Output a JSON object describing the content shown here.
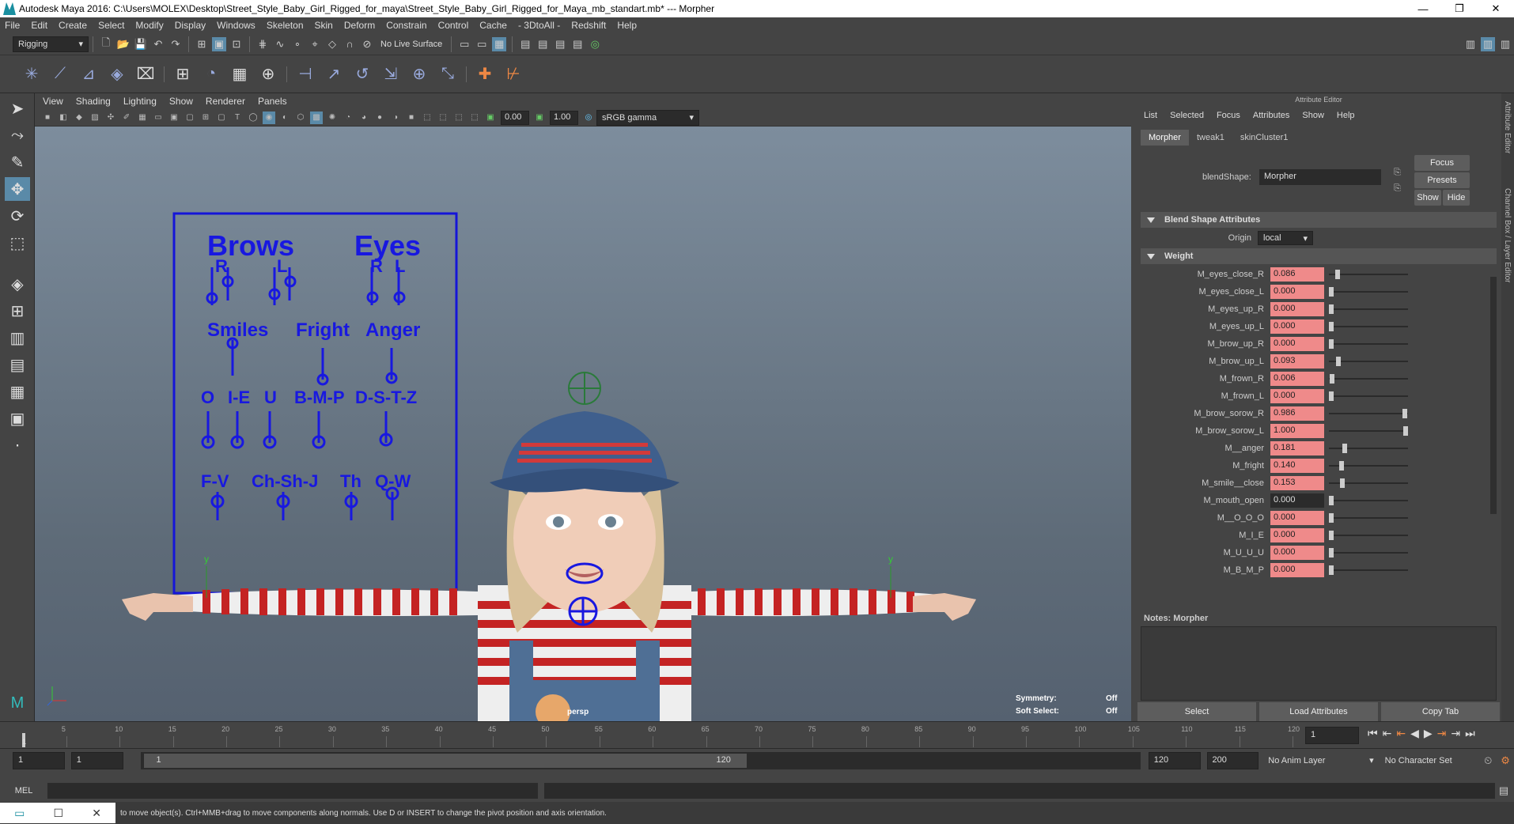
{
  "window": {
    "title": "Autodesk Maya 2016: C:\\Users\\MOLEX\\Desktop\\Street_Style_Baby_Girl_Rigged_for_maya\\Street_Style_Baby_Girl_Rigged_for_Maya_mb_standart.mb*  ---  Morpher",
    "minimize": "—",
    "maximize": "❐",
    "close": "✕"
  },
  "menubar": [
    "File",
    "Edit",
    "Create",
    "Select",
    "Modify",
    "Display",
    "Windows",
    "Skeleton",
    "Skin",
    "Deform",
    "Constrain",
    "Control",
    "Cache",
    "- 3DtoAll -",
    "Redshift",
    "Help"
  ],
  "toolbar": {
    "menuset": "Rigging",
    "live_surface": "No Live Surface"
  },
  "viewport": {
    "menu": [
      "View",
      "Shading",
      "Lighting",
      "Show",
      "Renderer",
      "Panels"
    ],
    "field1": "0.00",
    "field2": "1.00",
    "colorspace": "sRGB gamma",
    "camera": "persp",
    "hud": {
      "symmetry_label": "Symmetry:",
      "symmetry_value": "Off",
      "softselect_label": "Soft Select:",
      "softselect_value": "Off"
    },
    "rig_panel": {
      "brows": "Brows",
      "eyes": "Eyes",
      "r1": "R",
      "l1": "L",
      "r2": "R",
      "l2": "L",
      "smiles": "Smiles",
      "fright": "Fright",
      "anger": "Anger",
      "o": "O",
      "ie": "I-E",
      "u": "U",
      "bmp": "B-M-P",
      "dstz": "D-S-T-Z",
      "fv": "F-V",
      "chshj": "Ch-Sh-J",
      "th": "Th",
      "qw": "Q-W"
    },
    "axis_y": "y"
  },
  "attribute_editor": {
    "title": "Attribute Editor",
    "menu": [
      "List",
      "Selected",
      "Focus",
      "Attributes",
      "Show",
      "Help"
    ],
    "tabs": [
      "Morpher",
      "tweak1",
      "skinCluster1"
    ],
    "blendshape_label": "blendShape:",
    "blendshape_value": "Morpher",
    "focus": "Focus",
    "presets": "Presets",
    "show": "Show",
    "hide": "Hide",
    "section1": "Blend Shape Attributes",
    "origin_label": "Origin",
    "origin_value": "local",
    "section2": "Weight",
    "weights": [
      {
        "name": "M_eyes_close_R",
        "value": "0.086",
        "v": 0.086
      },
      {
        "name": "M_eyes_close_L",
        "value": "0.000",
        "v": 0.0
      },
      {
        "name": "M_eyes_up_R",
        "value": "0.000",
        "v": 0.0
      },
      {
        "name": "M_eyes_up_L",
        "value": "0.000",
        "v": 0.0
      },
      {
        "name": "M_brow_up_R",
        "value": "0.000",
        "v": 0.0
      },
      {
        "name": "M_brow_up_L",
        "value": "0.093",
        "v": 0.093
      },
      {
        "name": "M_frown_R",
        "value": "0.006",
        "v": 0.006
      },
      {
        "name": "M_frown_L",
        "value": "0.000",
        "v": 0.0
      },
      {
        "name": "M_brow_sorow_R",
        "value": "0.986",
        "v": 0.986
      },
      {
        "name": "M_brow_sorow_L",
        "value": "1.000",
        "v": 1.0
      },
      {
        "name": "M__anger",
        "value": "0.181",
        "v": 0.181
      },
      {
        "name": "M_fright",
        "value": "0.140",
        "v": 0.14
      },
      {
        "name": "M_smile__close",
        "value": "0.153",
        "v": 0.153
      },
      {
        "name": "M_mouth_open",
        "value": "0.000",
        "v": 0.0,
        "white": true
      },
      {
        "name": "M__O_O_O",
        "value": "0.000",
        "v": 0.0
      },
      {
        "name": "M_I_E",
        "value": "0.000",
        "v": 0.0
      },
      {
        "name": "M_U_U_U",
        "value": "0.000",
        "v": 0.0
      },
      {
        "name": "M_B_M_P",
        "value": "0.000",
        "v": 0.0
      }
    ],
    "notes_label": "Notes:  Morpher",
    "btn_select": "Select",
    "btn_load": "Load Attributes",
    "btn_copy": "Copy Tab"
  },
  "side_labels": {
    "attr": "Attribute Editor",
    "channel": "Channel Box / Layer Editor"
  },
  "timeline": {
    "ticks": [
      "5",
      "10",
      "15",
      "20",
      "25",
      "30",
      "35",
      "40",
      "45",
      "50",
      "55",
      "60",
      "65",
      "70",
      "75",
      "80",
      "85",
      "90",
      "95",
      "100",
      "105",
      "110",
      "115",
      "120"
    ],
    "current_frame": "1",
    "frame_box": "1"
  },
  "range": {
    "start": "1",
    "start2": "1",
    "slider_start": "1",
    "slider_end": "120",
    "end": "120",
    "end2": "200",
    "anim_layer": "No Anim Layer",
    "char_set": "No Character Set"
  },
  "cmdline": {
    "label": "MEL"
  },
  "helpline": {
    "text": "to move object(s). Ctrl+MMB+drag to move components along normals. Use D or INSERT to change the pivot position and axis orientation."
  }
}
